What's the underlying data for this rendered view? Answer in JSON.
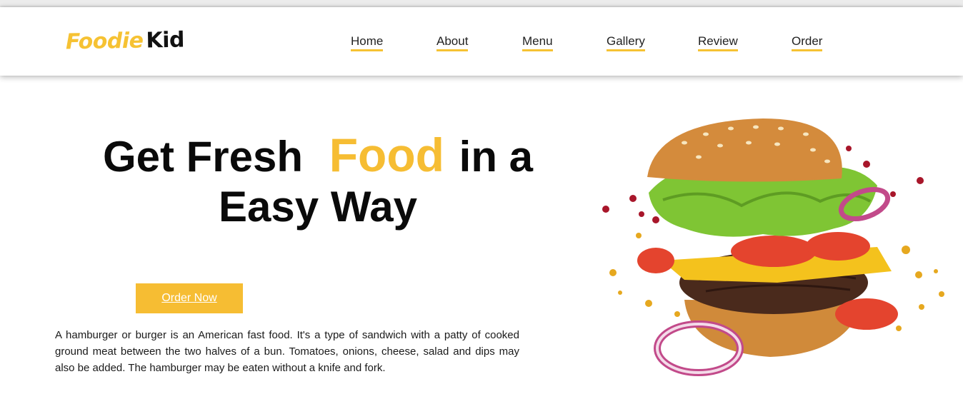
{
  "brand": {
    "logo_part1": "Foodie",
    "logo_part2": "Kid",
    "accent_color": "#f6bd33"
  },
  "nav": {
    "items": [
      {
        "label": "Home"
      },
      {
        "label": "About"
      },
      {
        "label": "Menu"
      },
      {
        "label": "Gallery"
      },
      {
        "label": "Review"
      },
      {
        "label": "Order"
      }
    ]
  },
  "hero": {
    "title_part1": "Get Fresh",
    "title_highlight": "Food",
    "title_part2": "in a",
    "title_line2": "Easy Way",
    "cta_label": "Order Now",
    "description": "A hamburger or burger is an American fast food. It's a type of sandwich with a patty of cooked ground meat between the two halves of a bun. Tomatoes, onions, cheese, salad and dips may also be added. The hamburger may be eaten without a knife and fork."
  },
  "illustration": {
    "icon": "burger-illustration"
  }
}
